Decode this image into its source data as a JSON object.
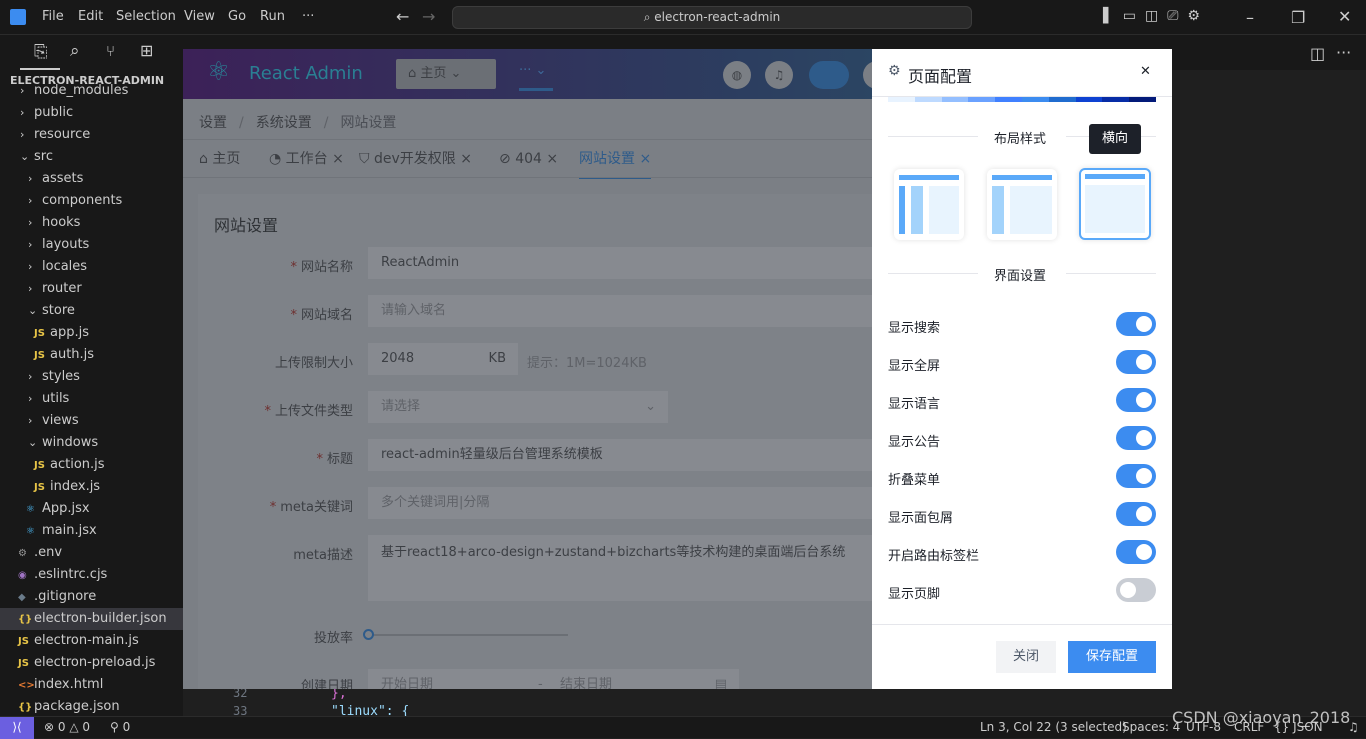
{
  "titlebar": {
    "menu": [
      "File",
      "Edit",
      "Selection",
      "View",
      "Go",
      "Run",
      "···"
    ],
    "search": "electron-react-admin"
  },
  "explorer": {
    "title": "ELECTRON-REACT-ADMIN",
    "items": [
      {
        "label": "node_modules",
        "type": "folder",
        "level": 1,
        "open": false
      },
      {
        "label": "public",
        "type": "folder",
        "level": 1,
        "open": false
      },
      {
        "label": "resource",
        "type": "folder",
        "level": 1,
        "open": false
      },
      {
        "label": "src",
        "type": "folder",
        "level": 1,
        "open": true
      },
      {
        "label": "assets",
        "type": "folder",
        "level": 2,
        "open": false
      },
      {
        "label": "components",
        "type": "folder",
        "level": 2,
        "open": false
      },
      {
        "label": "hooks",
        "type": "folder",
        "level": 2,
        "open": false
      },
      {
        "label": "layouts",
        "type": "folder",
        "level": 2,
        "open": false
      },
      {
        "label": "locales",
        "type": "folder",
        "level": 2,
        "open": false
      },
      {
        "label": "router",
        "type": "folder",
        "level": 2,
        "open": false
      },
      {
        "label": "store",
        "type": "folder",
        "level": 2,
        "open": true
      },
      {
        "label": "app.js",
        "type": "js",
        "level": 3
      },
      {
        "label": "auth.js",
        "type": "js",
        "level": 3
      },
      {
        "label": "styles",
        "type": "folder",
        "level": 2,
        "open": false
      },
      {
        "label": "utils",
        "type": "folder",
        "level": 2,
        "open": false
      },
      {
        "label": "views",
        "type": "folder",
        "level": 2,
        "open": false
      },
      {
        "label": "windows",
        "type": "folder",
        "level": 2,
        "open": true
      },
      {
        "label": "action.js",
        "type": "js",
        "level": 3
      },
      {
        "label": "index.js",
        "type": "js",
        "level": 3
      },
      {
        "label": "App.jsx",
        "type": "react",
        "level": 2
      },
      {
        "label": "main.jsx",
        "type": "react",
        "level": 2
      },
      {
        "label": ".env",
        "type": "env",
        "level": 1
      },
      {
        "label": ".eslintrc.cjs",
        "type": "eslint",
        "level": 1
      },
      {
        "label": ".gitignore",
        "type": "git",
        "level": 1
      },
      {
        "label": "electron-builder.json",
        "type": "json",
        "level": 1,
        "selected": true
      },
      {
        "label": "electron-main.js",
        "type": "js",
        "level": 1
      },
      {
        "label": "electron-preload.js",
        "type": "js",
        "level": 1
      },
      {
        "label": "index.html",
        "type": "html",
        "level": 1
      },
      {
        "label": "package.json",
        "type": "json",
        "level": 1
      }
    ]
  },
  "code": {
    "lines": [
      {
        "n": "32",
        "text": "},"
      },
      {
        "n": "33",
        "text": "\"linux\": {"
      }
    ]
  },
  "status": {
    "errors": "0",
    "warnings": "0",
    "ports": "0",
    "position": "Ln 3, Col 22 (3 selected)",
    "spaces": "Spaces: 4",
    "encoding": "UTF-8",
    "eol": "CRLF",
    "language": "{} JSON",
    "watermark": "CSDN @xiaoyan_2018"
  },
  "app": {
    "logo": "React Admin",
    "home_menu": "主页",
    "more": "···",
    "breadcrumb": [
      "设置",
      "系统设置",
      "网站设置"
    ],
    "tabs": [
      {
        "label": "主页",
        "icon": "home-icon",
        "closable": false
      },
      {
        "label": "工作台",
        "icon": "dashboard-icon",
        "closable": true
      },
      {
        "label": "dev开发权限",
        "icon": "shield-icon",
        "closable": true
      },
      {
        "label": "404",
        "icon": "stop-icon",
        "closable": true
      },
      {
        "label": "网站设置",
        "icon": "",
        "closable": true,
        "active": true
      }
    ],
    "form": {
      "title": "网站设置",
      "site_name": {
        "label": "网站名称",
        "value": "ReactAdmin"
      },
      "domain": {
        "label": "网站域名",
        "placeholder": "请输入域名"
      },
      "upload_limit": {
        "label": "上传限制大小",
        "value": "2048",
        "unit": "KB",
        "hint": "提示：1M=1024KB"
      },
      "file_type": {
        "label": "上传文件类型",
        "placeholder": "请选择"
      },
      "title_field": {
        "label": "标题",
        "value": "react-admin轻量级后台管理系统模板"
      },
      "keywords": {
        "label": "meta关键词",
        "placeholder": "多个关键词用|分隔"
      },
      "desc": {
        "label": "meta描述",
        "value": "基于react18+arco-design+zustand+bizcharts等技术构建的桌面端后台系统"
      },
      "rate": {
        "label": "投放率",
        "value": 0
      },
      "date": {
        "label": "创建日期",
        "start": "开始日期",
        "sep": "-",
        "end": "结束日期"
      }
    }
  },
  "drawer": {
    "title": "页面配置",
    "palette": [
      "#e8f3ff",
      "#bedaff",
      "#94bfff",
      "#6aa1ff",
      "#4080ff",
      "#3c8cf0",
      "#206ccf",
      "#0e42d2",
      "#072ca6",
      "#031a79"
    ],
    "layout_title": "布局样式",
    "layout_tooltip": "横向",
    "layout_selected": 3,
    "ui_title": "界面设置",
    "switches": [
      {
        "label": "显示搜索",
        "on": true
      },
      {
        "label": "显示全屏",
        "on": true
      },
      {
        "label": "显示语言",
        "on": true
      },
      {
        "label": "显示公告",
        "on": true
      },
      {
        "label": "折叠菜单",
        "on": true
      },
      {
        "label": "显示面包屑",
        "on": true
      },
      {
        "label": "开启路由标签栏",
        "on": true
      },
      {
        "label": "显示页脚",
        "on": false
      }
    ],
    "close": "关闭",
    "save": "保存配置",
    "accent": "#3c8cf0"
  }
}
